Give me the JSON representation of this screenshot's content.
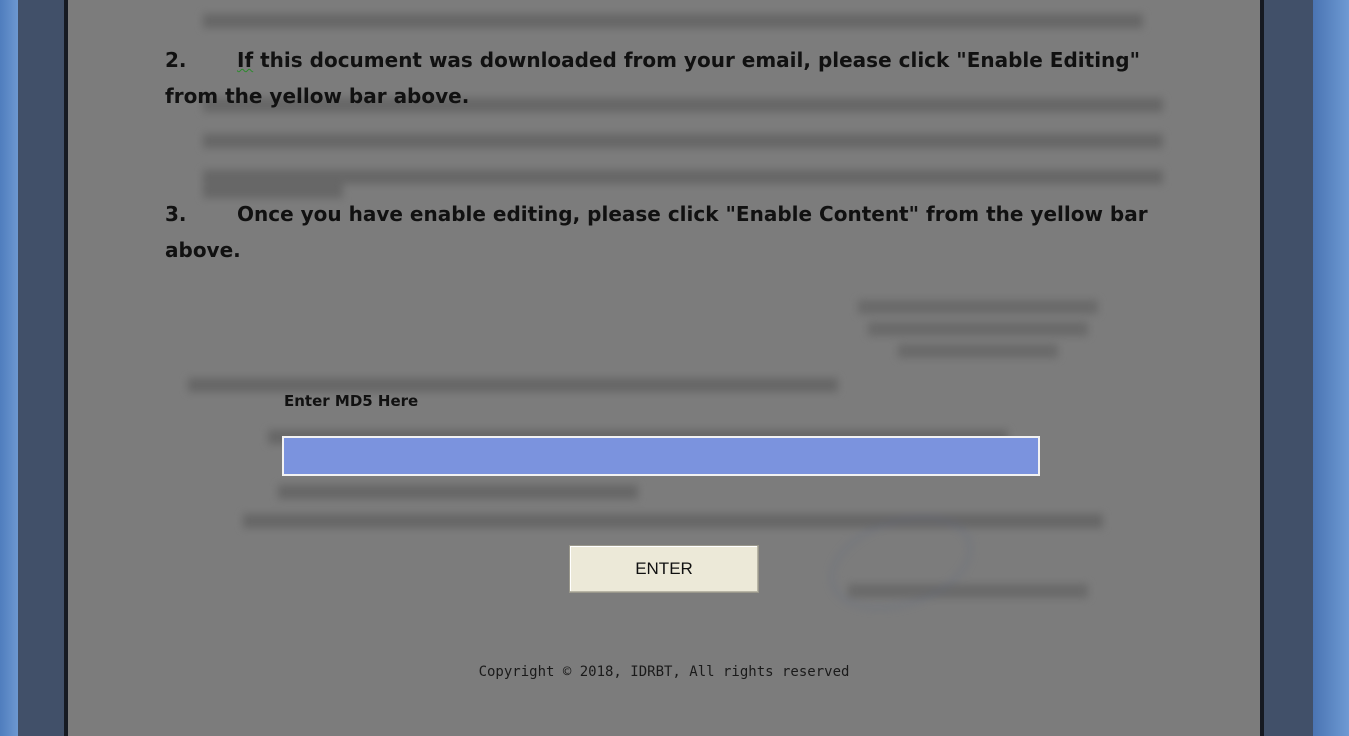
{
  "instructions": [
    {
      "num": "2.",
      "lead": "If",
      "text": " this document was downloaded from your email, please click  \"Enable Editing\" from the yellow bar above."
    },
    {
      "num": "3.",
      "lead": "",
      "text": "Once you have enable editing, please click  \"Enable Content\" from the yellow bar above."
    }
  ],
  "form": {
    "label": "Enter MD5 Here",
    "input_value": "",
    "button_label": "ENTER"
  },
  "footer": {
    "copyright": "Copyright © 2018, IDRBT, All rights reserved"
  },
  "colors": {
    "input_fill": "#7b93de",
    "button_fill": "#ece9d8",
    "document_overlay": "#7c7c7c",
    "frame": "#415069"
  }
}
